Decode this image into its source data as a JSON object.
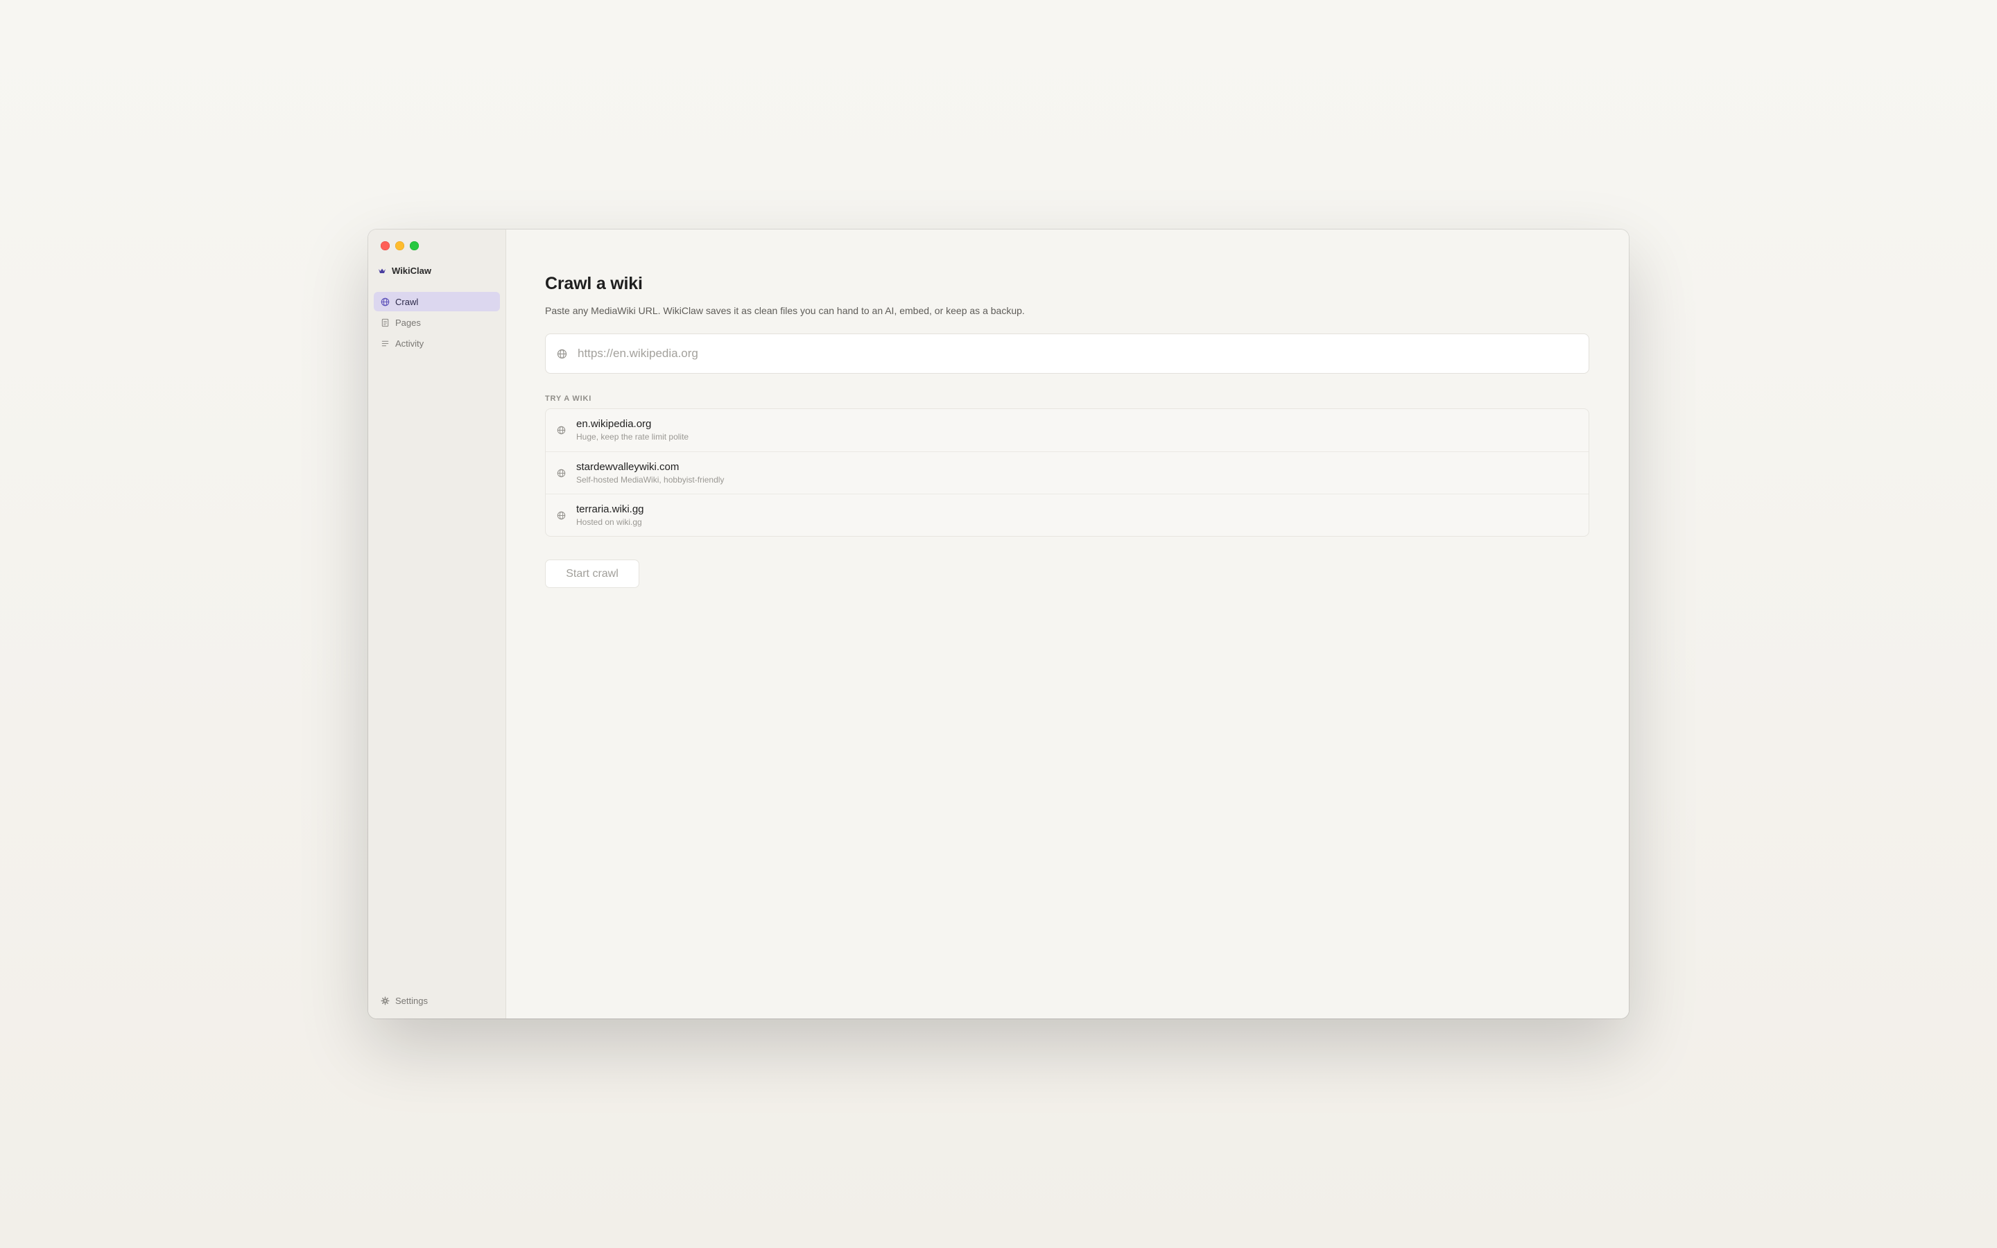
{
  "app": {
    "name": "WikiClaw"
  },
  "sidebar": {
    "items": [
      {
        "label": "Crawl",
        "icon": "globe-icon",
        "active": true
      },
      {
        "label": "Pages",
        "icon": "document-icon",
        "active": false
      },
      {
        "label": "Activity",
        "icon": "list-icon",
        "active": false
      }
    ],
    "settings_label": "Settings"
  },
  "main": {
    "title": "Crawl a wiki",
    "subtitle": "Paste any MediaWiki URL. WikiClaw saves it as clean files you can hand to an AI, embed, or keep as a backup.",
    "url_input": {
      "value": "",
      "placeholder": "https://en.wikipedia.org"
    },
    "suggestions_label": "TRY A WIKI",
    "suggestions": [
      {
        "title": "en.wikipedia.org",
        "desc": "Huge, keep the rate limit polite"
      },
      {
        "title": "stardewvalleywiki.com",
        "desc": "Self-hosted MediaWiki, hobbyist-friendly"
      },
      {
        "title": "terraria.wiki.gg",
        "desc": "Hosted on wiki.gg"
      }
    ],
    "start_button_label": "Start crawl"
  },
  "colors": {
    "accent": "#dcd7ef",
    "logo": "#4a3fa0",
    "window_close": "#fe5f57",
    "window_minimize": "#febc2e",
    "window_zoom": "#28c840"
  }
}
